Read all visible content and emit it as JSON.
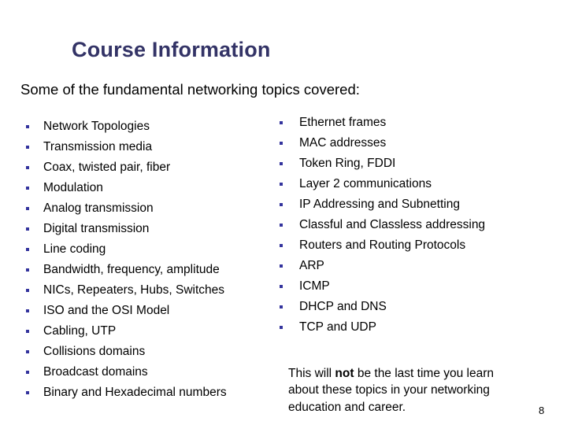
{
  "slide": {
    "title": "Course Information",
    "subtitle": "Some of the fundamental networking topics covered:",
    "page_number": "8",
    "colors": {
      "title": "#333366",
      "bullet_marker": "#33339D",
      "body_text": "#000000",
      "background": "#FFFFFF"
    },
    "bullet_icon": "square-bullet-icon",
    "columns": [
      {
        "name": "left-topics-column",
        "items": [
          "Network Topologies",
          "Transmission media",
          "Coax, twisted pair, fiber",
          "Modulation",
          "Analog transmission",
          "Digital transmission",
          "Line coding",
          "Bandwidth, frequency, amplitude",
          "NICs, Repeaters, Hubs, Switches",
          "ISO and the OSI Model",
          "Cabling, UTP",
          "Collisions domains",
          "Broadcast domains",
          "Binary and Hexadecimal numbers"
        ]
      },
      {
        "name": "right-topics-column",
        "items": [
          "Ethernet frames",
          "MAC addresses",
          "Token Ring, FDDI",
          "Layer 2 communications",
          "IP Addressing and Subnetting",
          "Classful and Classless addressing",
          "Routers and Routing Protocols",
          "ARP",
          "ICMP",
          "DHCP and DNS",
          "TCP and UDP"
        ]
      }
    ],
    "closing_note": {
      "before": "This will ",
      "emphasis": "not",
      "after": " be the last time you learn about these topics in your networking education and career."
    }
  }
}
